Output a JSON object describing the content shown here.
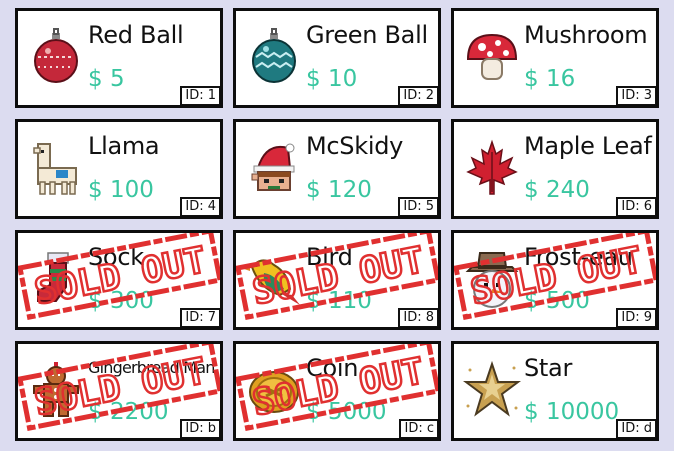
{
  "colors": {
    "background": "#dcdcf0",
    "price": "#39c6a0",
    "border": "#0d0d0d",
    "stamp": "#e03030"
  },
  "stamp_text": "SOLD OUT",
  "items": [
    {
      "name": "Red Ball",
      "price": "$ 5",
      "id": "ID: 1",
      "icon": "red-ornament-icon",
      "sold_out": false
    },
    {
      "name": "Green Ball",
      "price": "$ 10",
      "id": "ID: 2",
      "icon": "green-ornament-icon",
      "sold_out": false
    },
    {
      "name": "Mushroom",
      "price": "$ 16",
      "id": "ID: 3",
      "icon": "mushroom-icon",
      "sold_out": false
    },
    {
      "name": "Llama",
      "price": "$ 100",
      "id": "ID: 4",
      "icon": "llama-icon",
      "sold_out": false
    },
    {
      "name": "McSkidy",
      "price": "$ 120",
      "id": "ID: 5",
      "icon": "elf-icon",
      "sold_out": false
    },
    {
      "name": "Maple Leaf",
      "price": "$ 240",
      "id": "ID: 6",
      "icon": "maple-leaf-icon",
      "sold_out": false
    },
    {
      "name": "Sock",
      "price": "$ 300",
      "id": "ID: 7",
      "icon": "stocking-icon",
      "sold_out": true
    },
    {
      "name": "Bird",
      "price": "$ 110",
      "id": "ID: 8",
      "icon": "bird-icon",
      "sold_out": true
    },
    {
      "name": "Frost-eau",
      "price": "$ 500",
      "id": "ID: 9",
      "icon": "snowman-icon",
      "sold_out": true
    },
    {
      "name": "Gingerbread Man",
      "price": "$ 2200",
      "id": "ID: b",
      "icon": "gingerbread-man-icon",
      "sold_out": true
    },
    {
      "name": "Coin",
      "price": "$ 5000",
      "id": "ID: c",
      "icon": "coin-icon",
      "sold_out": true
    },
    {
      "name": "Star",
      "price": "$ 10000",
      "id": "ID: d",
      "icon": "star-ornament-icon",
      "sold_out": false
    }
  ]
}
